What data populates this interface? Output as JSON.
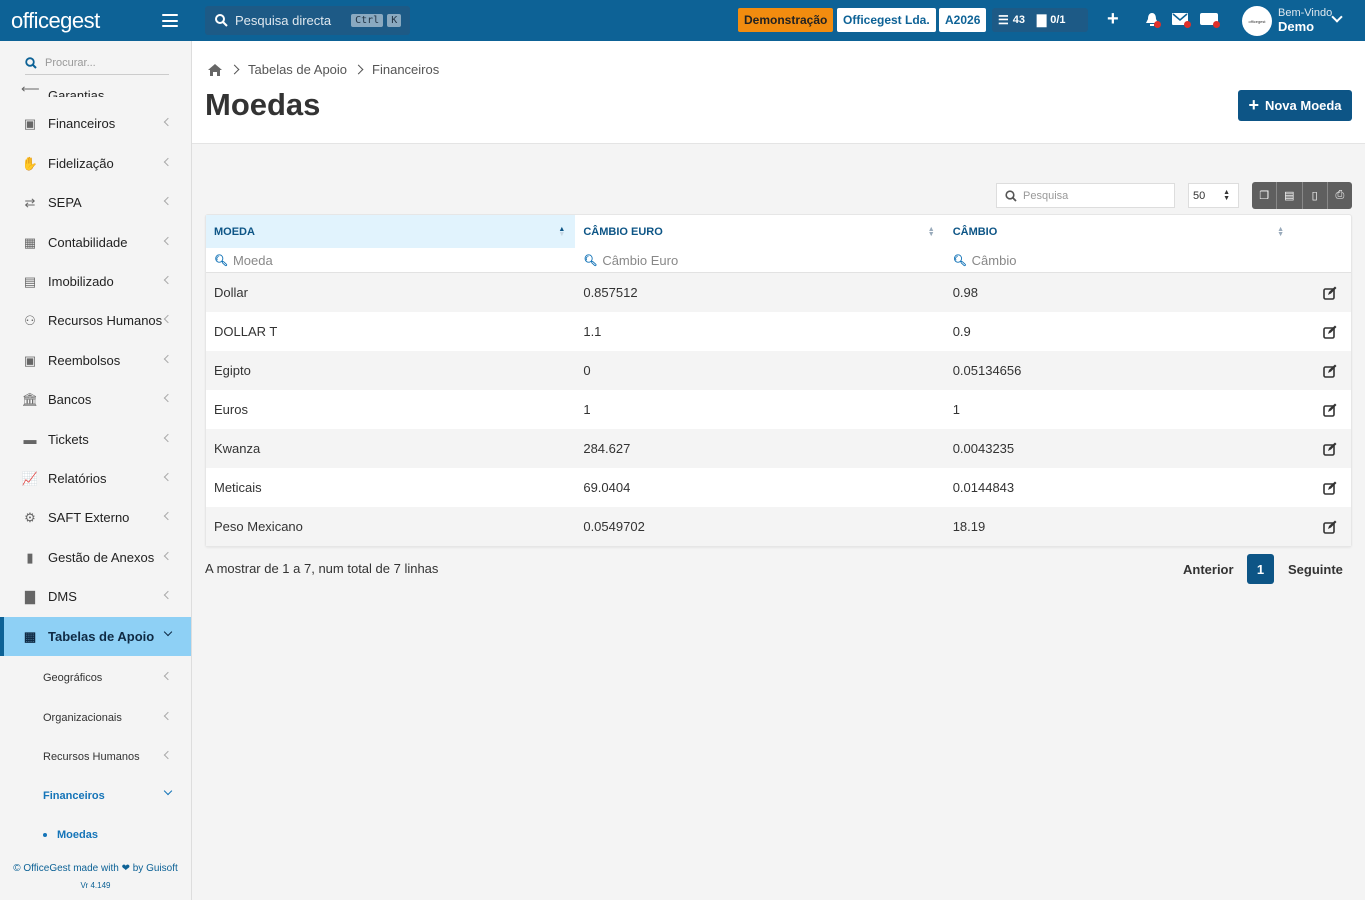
{
  "topbar": {
    "logo": "officegest",
    "search_placeholder": "Pesquisa directa",
    "search_kbd_1": "Ctrl",
    "search_kbd_2": "K",
    "badge_demo": "Demonstração",
    "badge_company": "Officegest Lda.",
    "badge_year": "A2026",
    "tasks_count": "43",
    "docs_count": "0/1",
    "welcome_small": "Bem-Vindo",
    "welcome_user": "Demo",
    "avatar_text": "officegest"
  },
  "sidebar": {
    "search_placeholder": "Procurar...",
    "items": [
      {
        "label": "Garantias"
      },
      {
        "label": "Financeiros"
      },
      {
        "label": "Fidelização"
      },
      {
        "label": "SEPA"
      },
      {
        "label": "Contabilidade"
      },
      {
        "label": "Imobilizado"
      },
      {
        "label": "Recursos Humanos"
      },
      {
        "label": "Reembolsos"
      },
      {
        "label": "Bancos"
      },
      {
        "label": "Tickets"
      },
      {
        "label": "Relatórios"
      },
      {
        "label": "SAFT Externo"
      },
      {
        "label": "Gestão de Anexos"
      },
      {
        "label": "DMS"
      },
      {
        "label": "Tabelas de Apoio"
      }
    ],
    "sub_items": [
      {
        "label": "Geográficos"
      },
      {
        "label": "Organizacionais"
      },
      {
        "label": "Recursos Humanos"
      },
      {
        "label": "Financeiros"
      }
    ],
    "leaf": "Moedas",
    "footer_line1": "© OfficeGest made with ❤ by Guisoft",
    "footer_line2": "Vr 4.149"
  },
  "breadcrumb": [
    "Tabelas de Apoio",
    "Financeiros"
  ],
  "page_title": "Moedas",
  "new_button": "Nova Moeda",
  "table_search_placeholder": "Pesquisa",
  "page_size": "50",
  "table": {
    "columns": [
      "MOEDA",
      "CÂMBIO EURO",
      "CÂMBIO"
    ],
    "filters": [
      "Moeda",
      "Câmbio Euro",
      "Câmbio"
    ],
    "rows": [
      [
        "Dollar",
        "0.857512",
        "0.98"
      ],
      [
        "DOLLAR T",
        "1.1",
        "0.9"
      ],
      [
        "Egipto",
        "0",
        "0.05134656"
      ],
      [
        "Euros",
        "1",
        "1"
      ],
      [
        "Kwanza",
        "284.627",
        "0.0043235"
      ],
      [
        "Meticais",
        "69.0404",
        "0.0144843"
      ],
      [
        "Peso Mexicano",
        "0.0549702",
        "18.19"
      ]
    ]
  },
  "info_text": "A mostrar de 1 a 7, num total de 7 linhas",
  "pager": {
    "prev": "Anterior",
    "current": "1",
    "next": "Seguinte"
  },
  "colors": {
    "primary": "#0d6296",
    "accent": "#f28c0f",
    "active": "#8ed0f5"
  }
}
